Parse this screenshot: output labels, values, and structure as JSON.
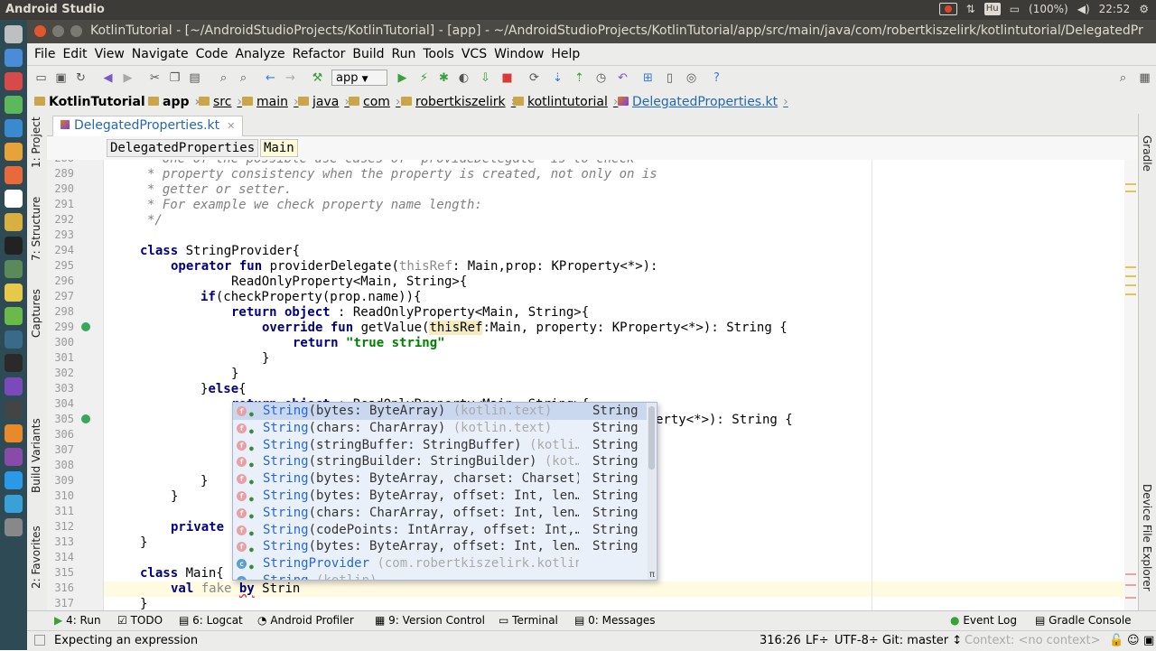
{
  "os_panel": {
    "app_name": "Android Studio",
    "input_indicator": "Hu",
    "battery": "(100%)",
    "time": "22:52"
  },
  "window": {
    "title": "KotlinTutorial - [~/AndroidStudioProjects/KotlinTutorial] - [app] - ~/AndroidStudioProjects/KotlinTutorial/app/src/main/java/com/robertkiszelirk/kotlintutorial/DelegatedPr"
  },
  "menu": [
    "File",
    "Edit",
    "View",
    "Navigate",
    "Code",
    "Analyze",
    "Refactor",
    "Build",
    "Run",
    "Tools",
    "VCS",
    "Window",
    "Help"
  ],
  "toolbar": {
    "run_config": "app"
  },
  "breadcrumbs": [
    "KotlinTutorial",
    "app",
    "src",
    "main",
    "java",
    "com",
    "robertkiszelirk",
    "kotlintutorial",
    "DelegatedProperties.kt"
  ],
  "tab": {
    "file_name": "DelegatedProperties.kt"
  },
  "structure_path": [
    "DelegatedProperties",
    "Main"
  ],
  "left_tool_windows": [
    "1: Project",
    "7: Structure",
    "Captures",
    "Build Variants",
    "2: Favorites"
  ],
  "right_tool_windows": [
    "Gradle",
    "Device File Explorer"
  ],
  "editor": {
    "line_numbers": [
      "288",
      "289",
      "290",
      "291",
      "292",
      "293",
      "294",
      "295",
      "296",
      "297",
      "298",
      "299",
      "300",
      "301",
      "302",
      "303",
      "304",
      "305",
      "306",
      "307",
      "308",
      "309",
      "310",
      "311",
      "312",
      "313",
      "314",
      "315",
      "316",
      "317"
    ],
    "lines": {
      "l288": "* One of the possible use cases of `provideDelegate` is to check",
      "l289": "* property consistency when the property is created, not only on is",
      "l290": "* getter or setter.",
      "l291": "* For example we check property name length:",
      "l292": "*/",
      "l294_kw": "class",
      "l294_rest": " StringProvider{",
      "l295_kw1": "operator",
      "l295_kw2": "fun",
      "l295_name": " providerDelegate(",
      "l295_param": "thisRef",
      "l295_rest": ": Main,prop: KProperty<*>):",
      "l296": "ReadOnlyProperty<Main, String>{",
      "l297_kw": "if",
      "l297_rest": "(checkProperty(prop.name)){",
      "l298_kw": "return object",
      "l298_rest": " : ReadOnlyProperty<Main, String>{",
      "l299_kw": "override fun",
      "l299_a": " getValue(",
      "l299_hl": "thisRef",
      "l299_b": ":Main, property: KProperty<*>): String {",
      "l300_kw": "return",
      "l300_str": "\"true string\"",
      "l301": "}",
      "l302": "}",
      "l303_a": "}",
      "l303_kw": "else",
      "l303_b": "{",
      "l304_kw": "return object",
      "l304_rest": " : ReadOnlyProperty<Main, String>{",
      "l305_tail": "erty<*>): String {",
      "l309": "}",
      "l310": "}",
      "l312_kw": "private",
      "l313": "}",
      "l315_kw": "class",
      "l315_rest": " Main{",
      "l316_kw": "val",
      "l316_name": " fake ",
      "l316_kw2": "by",
      "l316_rest": " Strin",
      "l317": "}"
    }
  },
  "completion": {
    "items": [
      {
        "name": "String",
        "args": "(bytes: ByteArray)",
        "pkg": " (kotlin.text)",
        "type": "String",
        "icon": "f"
      },
      {
        "name": "String",
        "args": "(chars: CharArray)",
        "pkg": " (kotlin.text)",
        "type": "String",
        "icon": "f"
      },
      {
        "name": "String",
        "args": "(stringBuffer: StringBuffer)",
        "pkg": " (kotli…",
        "type": "String",
        "icon": "f"
      },
      {
        "name": "String",
        "args": "(stringBuilder: StringBuilder)",
        "pkg": " (kot…",
        "type": "String",
        "icon": "f"
      },
      {
        "name": "String",
        "args": "(bytes: ByteArray, charset: Charset)",
        "pkg": "",
        "type": "String",
        "icon": "f"
      },
      {
        "name": "String",
        "args": "(bytes: ByteArray, offset: Int, len…",
        "pkg": "",
        "type": "String",
        "icon": "f"
      },
      {
        "name": "String",
        "args": "(chars: CharArray, offset: Int, len…",
        "pkg": "",
        "type": "String",
        "icon": "f"
      },
      {
        "name": "String",
        "args": "(codePoints: IntArray, offset: Int,…",
        "pkg": "",
        "type": "String",
        "icon": "f"
      },
      {
        "name": "String",
        "args": "(bytes: ByteArray, offset: Int, len…",
        "pkg": "",
        "type": "String",
        "icon": "f"
      },
      {
        "name": "StringProvider",
        "args": "",
        "pkg": " (com.robertkiszelirk.kotlintutori…",
        "type": "",
        "icon": "c"
      },
      {
        "name": "String",
        "args": "",
        "pkg": " (kotlin)",
        "type": "",
        "icon": "c"
      }
    ],
    "pi_symbol": "π"
  },
  "bottom_tools": {
    "run": "4: Run",
    "todo": "TODO",
    "logcat": "6: Logcat",
    "profiler": "Android Profiler",
    "vcs": "9: Version Control",
    "terminal": "Terminal",
    "messages": "0: Messages",
    "event_log": "Event Log",
    "gradle_console": "Gradle Console"
  },
  "status": {
    "message": "Expecting an expression",
    "position": "316:26",
    "line_sep": "LF÷",
    "encoding": "UTF-8÷",
    "git": "Git: master ↕",
    "context": "Context: <no context>"
  },
  "colors": {
    "keyword": "#000080",
    "comment": "#808080",
    "string": "#008000",
    "popup_bg": "#eaf0fa",
    "popup_selected": "#cad8ef",
    "completion_name": "#2468d6"
  }
}
